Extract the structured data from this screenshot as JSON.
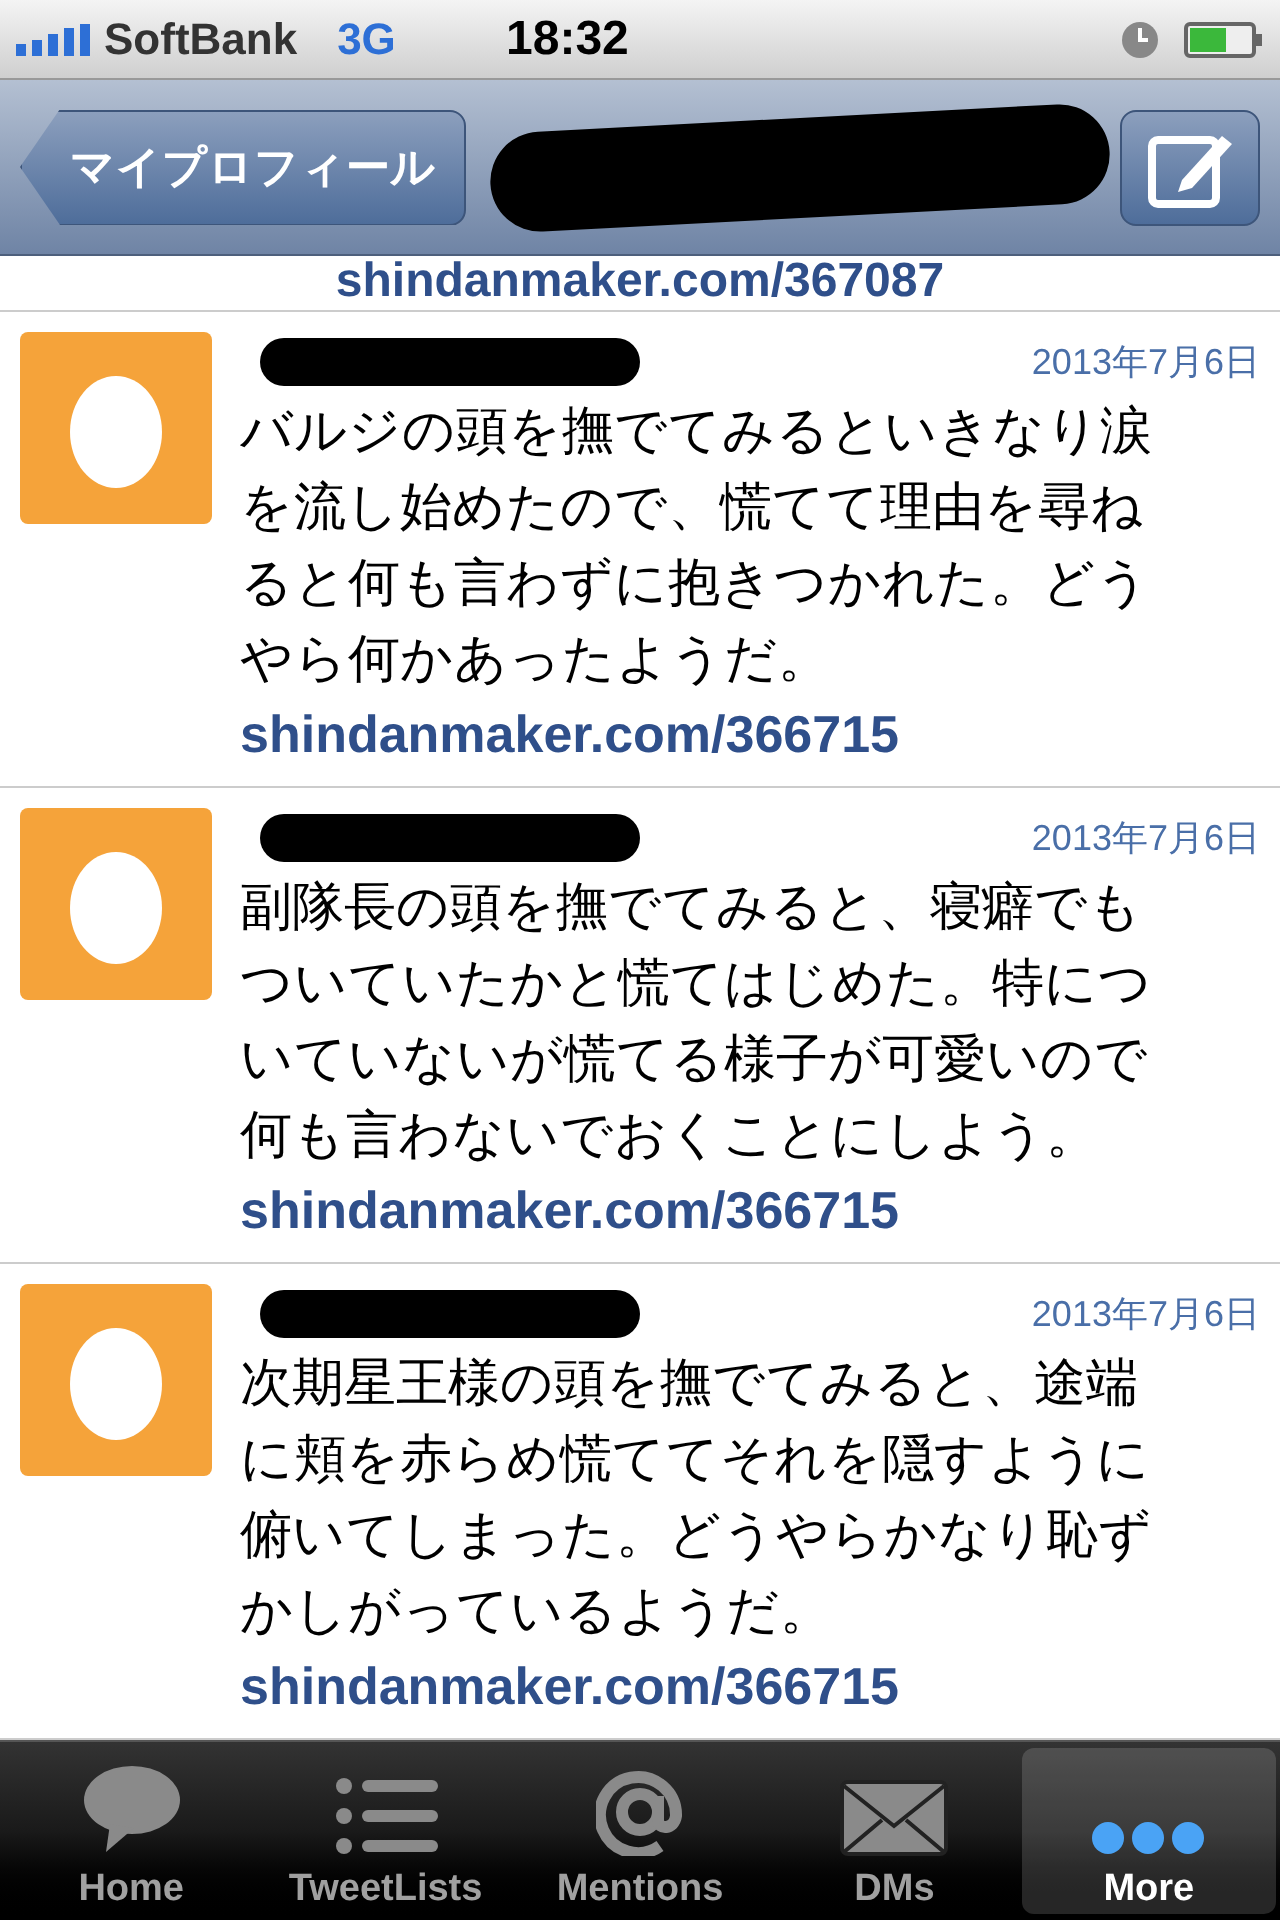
{
  "status_bar": {
    "carrier": "SoftBank",
    "network": "3G",
    "time": "18:32"
  },
  "nav_bar": {
    "back": "マイプロフィール",
    "title_redacted": true
  },
  "partial_link": "shindanmaker.com/367087",
  "tweets": [
    {
      "name_redacted": true,
      "date": "2013年7月6日",
      "text": "バルジの頭を撫でてみるといきなり涙を流し始めたので、慌てて理由を尋ねると何も言わずに抱きつかれた。どうやら何かあったようだ。",
      "link": "shindanmaker.com/366715"
    },
    {
      "name_redacted": true,
      "date": "2013年7月6日",
      "text": "副隊長の頭を撫でてみると、寝癖でもついていたかと慌てはじめた。特についていないが慌てる様子が可愛いので何も言わないでおくことにしよう。",
      "link": "shindanmaker.com/366715"
    },
    {
      "name_redacted": true,
      "date": "2013年7月6日",
      "text": "次期星王様の頭を撫でてみると、途端に頬を赤らめ慌ててそれを隠すように俯いてしまった。どうやらかなり恥ずかしがっているようだ。",
      "link": "shindanmaker.com/366715"
    }
  ],
  "tabs": [
    {
      "label": "Home",
      "kind": "bubble",
      "selected": false
    },
    {
      "label": "TweetLists",
      "kind": "list",
      "selected": false
    },
    {
      "label": "Mentions",
      "kind": "at",
      "selected": false
    },
    {
      "label": "DMs",
      "kind": "mail",
      "selected": false
    },
    {
      "label": "More",
      "kind": "dots",
      "selected": true
    }
  ]
}
